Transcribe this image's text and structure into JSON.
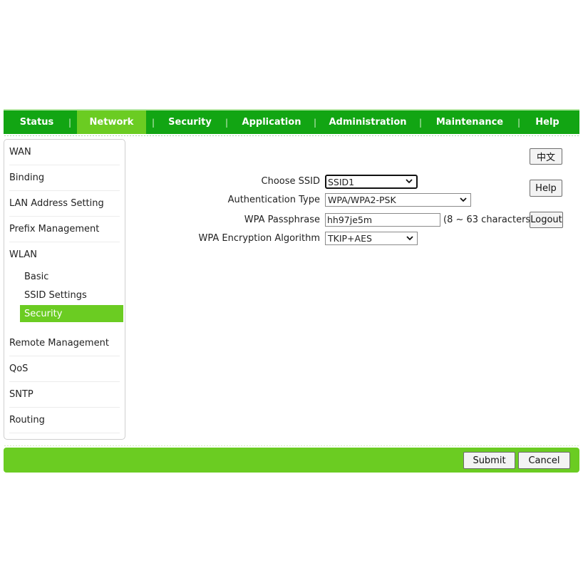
{
  "topnav": {
    "tabs": [
      {
        "label": "Status",
        "active": false
      },
      {
        "label": "Network",
        "active": true
      },
      {
        "label": "Security",
        "active": false
      },
      {
        "label": "Application",
        "active": false
      },
      {
        "label": "Administration",
        "active": false
      },
      {
        "label": "Maintenance",
        "active": false
      },
      {
        "label": "Help",
        "active": false
      }
    ],
    "separator": "|"
  },
  "sidebar": {
    "items": [
      {
        "label": "WAN"
      },
      {
        "label": "Binding"
      },
      {
        "label": "LAN Address Setting"
      },
      {
        "label": "Prefix Management"
      },
      {
        "label": "WLAN"
      },
      {
        "label": "Remote Management"
      },
      {
        "label": "QoS"
      },
      {
        "label": "SNTP"
      },
      {
        "label": "Routing"
      }
    ],
    "wlan_subitems": [
      {
        "label": "Basic",
        "active": false
      },
      {
        "label": "SSID Settings",
        "active": false
      },
      {
        "label": "Security",
        "active": true
      }
    ]
  },
  "form": {
    "ssid": {
      "label": "Choose SSID",
      "value": "SSID1"
    },
    "auth": {
      "label": "Authentication Type",
      "value": "WPA/WPA2-PSK"
    },
    "passphrase": {
      "label": "WPA Passphrase",
      "value": "hh97je5m",
      "hint": "(8 ~ 63 characters)"
    },
    "encryption": {
      "label": "WPA Encryption Algorithm",
      "value": "TKIP+AES"
    }
  },
  "side_buttons": {
    "language": "中文",
    "help": "Help",
    "logout": "Logout"
  },
  "bottom": {
    "submit": "Submit",
    "cancel": "Cancel"
  },
  "colors": {
    "nav_green": "#12a513",
    "accent_green": "#6bcc22"
  }
}
